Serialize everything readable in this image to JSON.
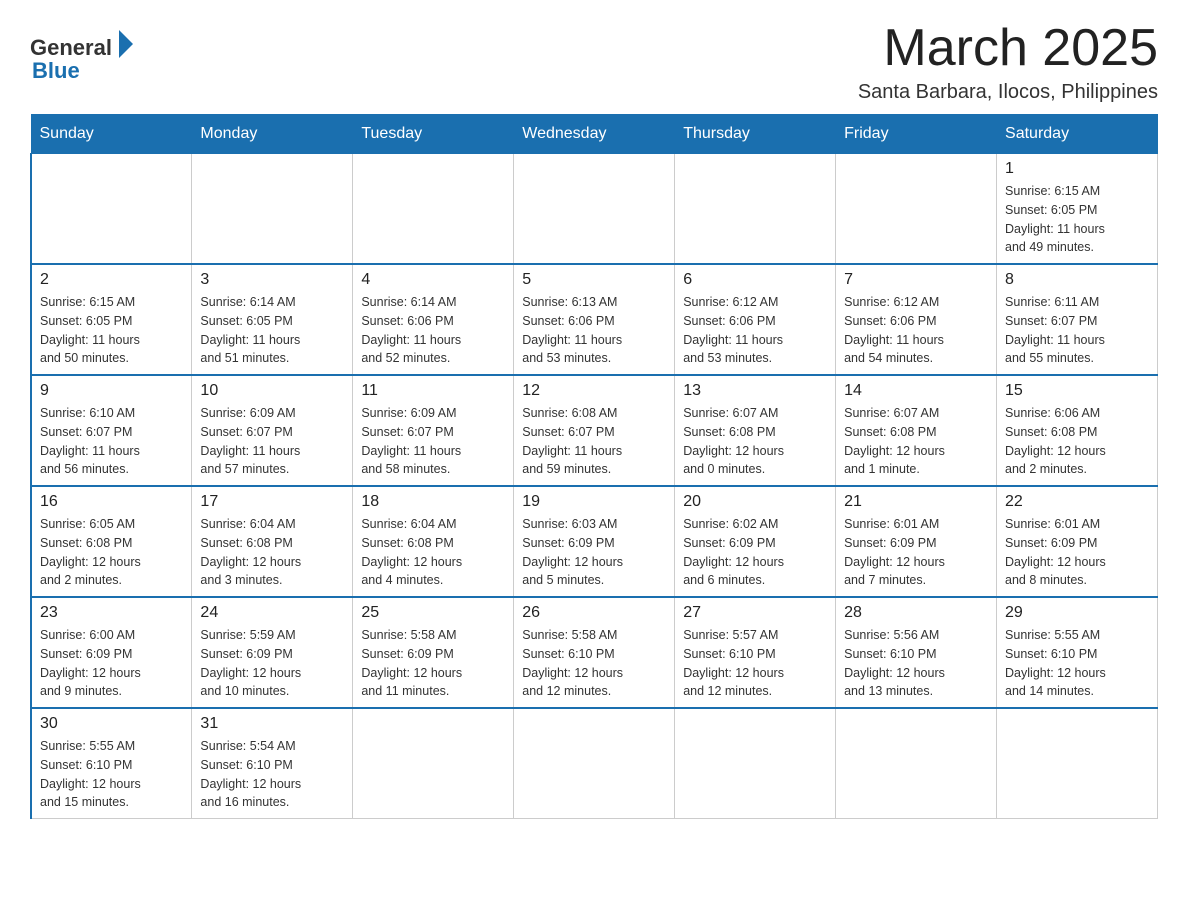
{
  "header": {
    "logo_general": "General",
    "logo_blue": "Blue",
    "month_year": "March 2025",
    "location": "Santa Barbara, Ilocos, Philippines"
  },
  "days_of_week": [
    "Sunday",
    "Monday",
    "Tuesday",
    "Wednesday",
    "Thursday",
    "Friday",
    "Saturday"
  ],
  "weeks": [
    [
      {
        "day": "",
        "info": ""
      },
      {
        "day": "",
        "info": ""
      },
      {
        "day": "",
        "info": ""
      },
      {
        "day": "",
        "info": ""
      },
      {
        "day": "",
        "info": ""
      },
      {
        "day": "",
        "info": ""
      },
      {
        "day": "1",
        "info": "Sunrise: 6:15 AM\nSunset: 6:05 PM\nDaylight: 11 hours\nand 49 minutes."
      }
    ],
    [
      {
        "day": "2",
        "info": "Sunrise: 6:15 AM\nSunset: 6:05 PM\nDaylight: 11 hours\nand 50 minutes."
      },
      {
        "day": "3",
        "info": "Sunrise: 6:14 AM\nSunset: 6:05 PM\nDaylight: 11 hours\nand 51 minutes."
      },
      {
        "day": "4",
        "info": "Sunrise: 6:14 AM\nSunset: 6:06 PM\nDaylight: 11 hours\nand 52 minutes."
      },
      {
        "day": "5",
        "info": "Sunrise: 6:13 AM\nSunset: 6:06 PM\nDaylight: 11 hours\nand 53 minutes."
      },
      {
        "day": "6",
        "info": "Sunrise: 6:12 AM\nSunset: 6:06 PM\nDaylight: 11 hours\nand 53 minutes."
      },
      {
        "day": "7",
        "info": "Sunrise: 6:12 AM\nSunset: 6:06 PM\nDaylight: 11 hours\nand 54 minutes."
      },
      {
        "day": "8",
        "info": "Sunrise: 6:11 AM\nSunset: 6:07 PM\nDaylight: 11 hours\nand 55 minutes."
      }
    ],
    [
      {
        "day": "9",
        "info": "Sunrise: 6:10 AM\nSunset: 6:07 PM\nDaylight: 11 hours\nand 56 minutes."
      },
      {
        "day": "10",
        "info": "Sunrise: 6:09 AM\nSunset: 6:07 PM\nDaylight: 11 hours\nand 57 minutes."
      },
      {
        "day": "11",
        "info": "Sunrise: 6:09 AM\nSunset: 6:07 PM\nDaylight: 11 hours\nand 58 minutes."
      },
      {
        "day": "12",
        "info": "Sunrise: 6:08 AM\nSunset: 6:07 PM\nDaylight: 11 hours\nand 59 minutes."
      },
      {
        "day": "13",
        "info": "Sunrise: 6:07 AM\nSunset: 6:08 PM\nDaylight: 12 hours\nand 0 minutes."
      },
      {
        "day": "14",
        "info": "Sunrise: 6:07 AM\nSunset: 6:08 PM\nDaylight: 12 hours\nand 1 minute."
      },
      {
        "day": "15",
        "info": "Sunrise: 6:06 AM\nSunset: 6:08 PM\nDaylight: 12 hours\nand 2 minutes."
      }
    ],
    [
      {
        "day": "16",
        "info": "Sunrise: 6:05 AM\nSunset: 6:08 PM\nDaylight: 12 hours\nand 2 minutes."
      },
      {
        "day": "17",
        "info": "Sunrise: 6:04 AM\nSunset: 6:08 PM\nDaylight: 12 hours\nand 3 minutes."
      },
      {
        "day": "18",
        "info": "Sunrise: 6:04 AM\nSunset: 6:08 PM\nDaylight: 12 hours\nand 4 minutes."
      },
      {
        "day": "19",
        "info": "Sunrise: 6:03 AM\nSunset: 6:09 PM\nDaylight: 12 hours\nand 5 minutes."
      },
      {
        "day": "20",
        "info": "Sunrise: 6:02 AM\nSunset: 6:09 PM\nDaylight: 12 hours\nand 6 minutes."
      },
      {
        "day": "21",
        "info": "Sunrise: 6:01 AM\nSunset: 6:09 PM\nDaylight: 12 hours\nand 7 minutes."
      },
      {
        "day": "22",
        "info": "Sunrise: 6:01 AM\nSunset: 6:09 PM\nDaylight: 12 hours\nand 8 minutes."
      }
    ],
    [
      {
        "day": "23",
        "info": "Sunrise: 6:00 AM\nSunset: 6:09 PM\nDaylight: 12 hours\nand 9 minutes."
      },
      {
        "day": "24",
        "info": "Sunrise: 5:59 AM\nSunset: 6:09 PM\nDaylight: 12 hours\nand 10 minutes."
      },
      {
        "day": "25",
        "info": "Sunrise: 5:58 AM\nSunset: 6:09 PM\nDaylight: 12 hours\nand 11 minutes."
      },
      {
        "day": "26",
        "info": "Sunrise: 5:58 AM\nSunset: 6:10 PM\nDaylight: 12 hours\nand 12 minutes."
      },
      {
        "day": "27",
        "info": "Sunrise: 5:57 AM\nSunset: 6:10 PM\nDaylight: 12 hours\nand 12 minutes."
      },
      {
        "day": "28",
        "info": "Sunrise: 5:56 AM\nSunset: 6:10 PM\nDaylight: 12 hours\nand 13 minutes."
      },
      {
        "day": "29",
        "info": "Sunrise: 5:55 AM\nSunset: 6:10 PM\nDaylight: 12 hours\nand 14 minutes."
      }
    ],
    [
      {
        "day": "30",
        "info": "Sunrise: 5:55 AM\nSunset: 6:10 PM\nDaylight: 12 hours\nand 15 minutes."
      },
      {
        "day": "31",
        "info": "Sunrise: 5:54 AM\nSunset: 6:10 PM\nDaylight: 12 hours\nand 16 minutes."
      },
      {
        "day": "",
        "info": ""
      },
      {
        "day": "",
        "info": ""
      },
      {
        "day": "",
        "info": ""
      },
      {
        "day": "",
        "info": ""
      },
      {
        "day": "",
        "info": ""
      }
    ]
  ]
}
